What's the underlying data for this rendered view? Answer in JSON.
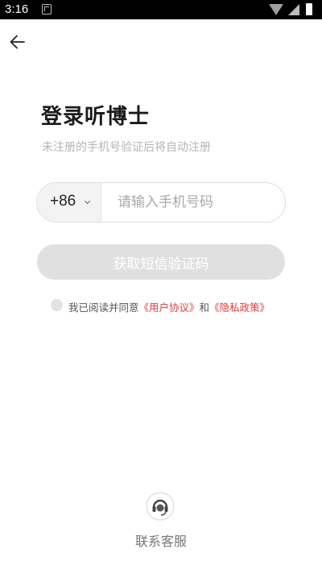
{
  "status_bar": {
    "time": "3:16"
  },
  "header": {
    "back_icon": "arrow-left-icon"
  },
  "login": {
    "title": "登录听博士",
    "subtitle": "未注册的手机号验证后将自动注册",
    "country_code": "+86",
    "phone_placeholder": "请输入手机号码",
    "phone_value": "",
    "sms_button_label": "获取短信验证码"
  },
  "agreement": {
    "prefix": "我已阅读并同意",
    "user_agreement": "《用户协议》",
    "conjunction": "和",
    "privacy_policy": "《隐私政策》",
    "checked": false
  },
  "support": {
    "icon": "headset-icon",
    "label": "联系客服"
  },
  "colors": {
    "accent_link": "#e23b3b",
    "button_disabled": "#e0e0e0",
    "subtitle": "#b4b4b4"
  }
}
